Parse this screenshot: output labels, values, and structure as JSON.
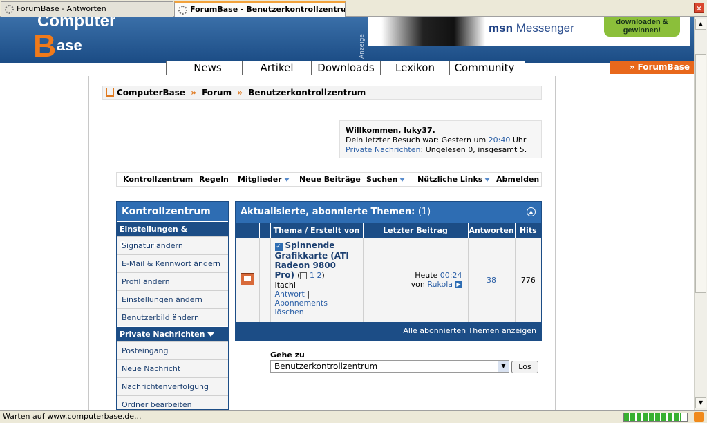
{
  "tabs": [
    {
      "label": "ForumBase - Antworten"
    },
    {
      "label": "ForumBase - Benutzerkontrollzentrum"
    }
  ],
  "header": {
    "logo": "ComputerBase",
    "ad_label": "Anzeige",
    "ad_brand": "msn",
    "ad_product": "Messenger",
    "ad_cta": "downloaden & gewinnen!"
  },
  "mainnav": [
    "News",
    "Artikel",
    "Downloads",
    "Lexikon",
    "Community"
  ],
  "forumbase_tab": "» ForumBase",
  "breadcrumb": [
    "ComputerBase",
    "Forum",
    "Benutzerkontrollzentrum"
  ],
  "breadcrumb_sep": "»",
  "welcome": {
    "title": "Willkommen, luky37.",
    "last_visit_prefix": "Dein letzter Besuch war: Gestern um",
    "last_visit_time": "20:40",
    "last_visit_suffix": "Uhr",
    "pm_link": "Private Nachrichten",
    "pm_text": ": Ungelesen 0, insgesamt 5."
  },
  "subnav": [
    "Kontrollzentrum",
    "Regeln",
    "Mitglieder",
    "Neue Beiträge",
    "Suchen",
    "Nützliche Links",
    "Abmelden"
  ],
  "sidebar": {
    "title": "Kontrollzentrum",
    "section1": "Einstellungen & Optionen",
    "items1": [
      "Signatur ändern",
      "E-Mail & Kennwort ändern",
      "Profil ändern",
      "Einstellungen ändern",
      "Benutzerbild ändern"
    ],
    "section2": "Private Nachrichten",
    "items2": [
      "Posteingang",
      "Neue Nachricht",
      "Nachrichtenverfolgung",
      "Ordner bearbeiten"
    ]
  },
  "panel": {
    "title": "Aktualisierte, abonnierte Themen:",
    "count": "(1)",
    "columns": [
      "Thema / Erstellt von",
      "Letzter Beitrag",
      "Antworten",
      "Hits"
    ],
    "thread": {
      "title": "Spinnende Grafikkarte (ATI Radeon 9800 Pro)",
      "pages_open": "(",
      "page1": "1",
      "page2": "2",
      "pages_close": ")",
      "author": "Itachi",
      "action1": "Antwort",
      "action_sep": "|",
      "action2": "Abonnements löschen",
      "last_day": "Heute",
      "last_time": "00:24",
      "last_by_prefix": "von",
      "last_by": "Rukola",
      "replies": "38",
      "hits": "776"
    },
    "footer": "Alle abonnierten Themen anzeigen"
  },
  "goto": {
    "label": "Gehe zu",
    "selected": "Benutzerkontrollzentrum",
    "button": "Los"
  },
  "status": {
    "text": "Warten auf www.computerbase.de...",
    "progress": 0.9
  }
}
